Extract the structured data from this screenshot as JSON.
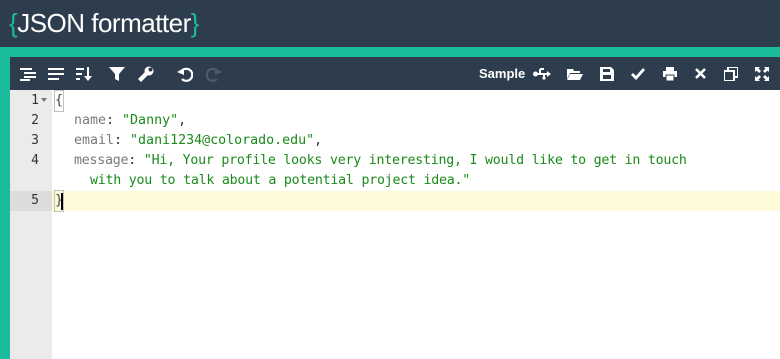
{
  "header": {
    "brand_open": "{",
    "brand_text": "JSON formatter",
    "brand_close": "}"
  },
  "toolbar": {
    "sample_label": "Sample",
    "left_tools": [
      "format-icon",
      "compact-icon",
      "sort-icon",
      "filter-icon",
      "repair-icon",
      "undo-icon",
      "redo-icon"
    ],
    "right_tools": [
      "usb-icon",
      "open-folder-icon",
      "save-icon",
      "validate-check-icon",
      "print-icon",
      "clear-icon",
      "copy-icon",
      "fullscreen-icon"
    ]
  },
  "editor": {
    "line_numbers": [
      "1",
      "2",
      "3",
      "4",
      "5"
    ],
    "active_line": 5,
    "lines": {
      "l1": {
        "open_brace": "{"
      },
      "l2": {
        "key": "name",
        "colon": ": ",
        "value": "\"Danny\"",
        "comma": ","
      },
      "l3": {
        "key": "email",
        "colon": ": ",
        "value": "\"dani1234@colorado.edu\"",
        "comma": ","
      },
      "l4": {
        "key": "message",
        "colon": ": ",
        "value_part1": "\"Hi, Your profile looks very interesting, I would like to get in touch",
        "value_part2": "with you to talk about a potential project idea.\""
      },
      "l5": {
        "close_brace": "}"
      }
    }
  },
  "colors": {
    "header_bg": "#2e3d4d",
    "accent": "#1abc9c",
    "string": "#1a8a1a",
    "key": "#7a7a7a",
    "active_line_bg": "#fcfad9"
  }
}
